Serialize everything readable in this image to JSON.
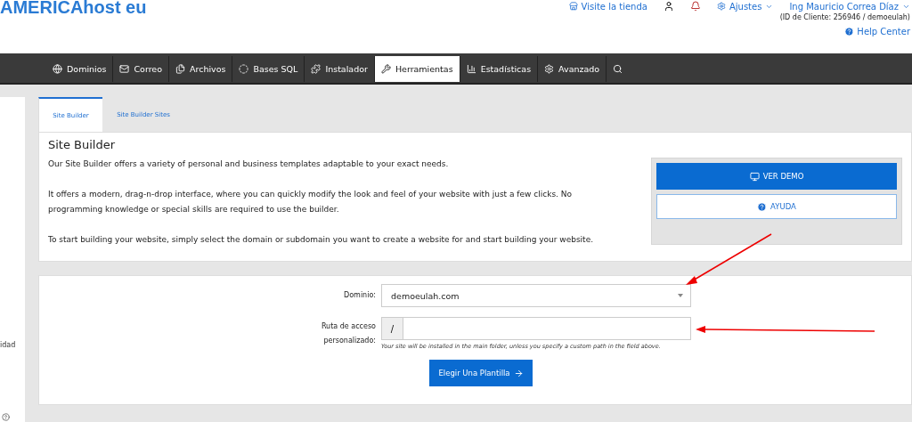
{
  "header": {
    "logo": "AMERICAhost eu",
    "store_link": "Visite la tienda",
    "settings": "Ajustes",
    "user": "Ing Mauricio Correa Díaz",
    "client_id": "(ID de Cliente: 256946 / demoeulah)",
    "help": "Help Center"
  },
  "nav": [
    {
      "label": "Dominios",
      "selected": false
    },
    {
      "label": "Correo",
      "selected": false
    },
    {
      "label": "Archivos",
      "selected": false
    },
    {
      "label": "Bases SQL",
      "selected": false
    },
    {
      "label": "Instalador",
      "selected": false
    },
    {
      "label": "Herramientas",
      "selected": true
    },
    {
      "label": "Estadísticas",
      "selected": false
    },
    {
      "label": "Avanzado",
      "selected": false
    }
  ],
  "sidebar": {
    "text": "idad"
  },
  "tabs": [
    {
      "label": "Site Builder",
      "selected": true
    },
    {
      "label": "Site Builder Sites",
      "selected": false
    }
  ],
  "intro": {
    "title": "Site Builder",
    "paragraphs": [
      "Our Site Builder offers a variety of personal and business templates adaptable to your exact needs.",
      "It offers a modern, drag-n-drop interface, where you can quickly modify the look and feel of your website with just a few clicks. No programming knowledge or special skills are required to use the builder.",
      "To start building your website, simply select the domain or subdomain you want to create a website for and start building your website."
    ],
    "demo_button": "VER DEMO",
    "help_button": "AYUDA"
  },
  "form": {
    "domain_label": "Dominio:",
    "domain_value": "demoeulah.com",
    "path_label": "Ruta de acceso personalizado:",
    "path_prefix": "/",
    "hint": "Your site will be installed in the main folder, unless you specify a custom path in the field above.",
    "submit": "Elegir Una Plantilla"
  }
}
